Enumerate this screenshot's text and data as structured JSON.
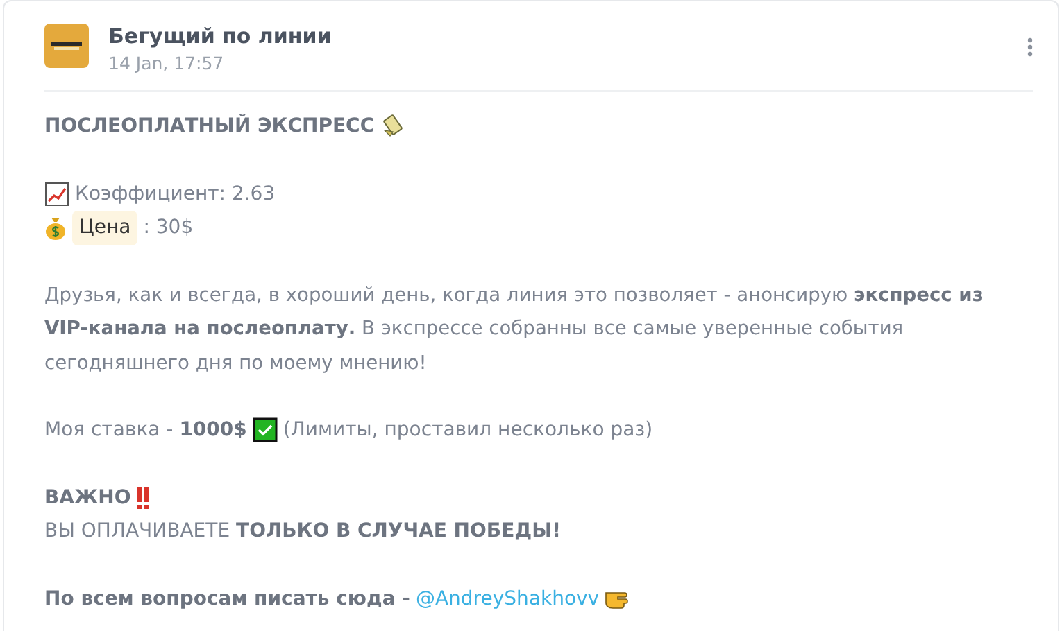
{
  "post": {
    "author": "Бегущий по линии",
    "time": "14 Jan, 17:57"
  },
  "blocks": [
    {
      "kind": "title",
      "text": "ПОСЛЕОПЛАТНЫЙ ЭКСПРЕСС"
    },
    {
      "kind": "odds",
      "text": "Коэффициент: 2.63"
    },
    {
      "kind": "price",
      "chip": "Цена",
      "text": ": 30$"
    },
    {
      "kind": "paragraph",
      "text": "Друзья, как и всегда, в хороший день, когда линия это позволяет - анонсирую **экспресс из VIP-канала на послеоплату.** В экспрессе собранны все самые уверенные события сегодняшнего дня по моему мнению!"
    },
    {
      "kind": "stake",
      "text": "Моя ставка - **1000$**",
      "note": "(Лимиты, проставил несколько раз)"
    },
    {
      "kind": "important",
      "text": "ВАЖНО"
    },
    {
      "kind": "notice",
      "text": "ВЫ ОПЛАЧИВАЕТЕ **ТОЛЬКО В СЛУЧАЕ ПОБЕДЫ!**"
    },
    {
      "kind": "contact",
      "text": "По всем вопросам писать сюда -",
      "link": "@AndreyShakhovv"
    }
  ]
}
